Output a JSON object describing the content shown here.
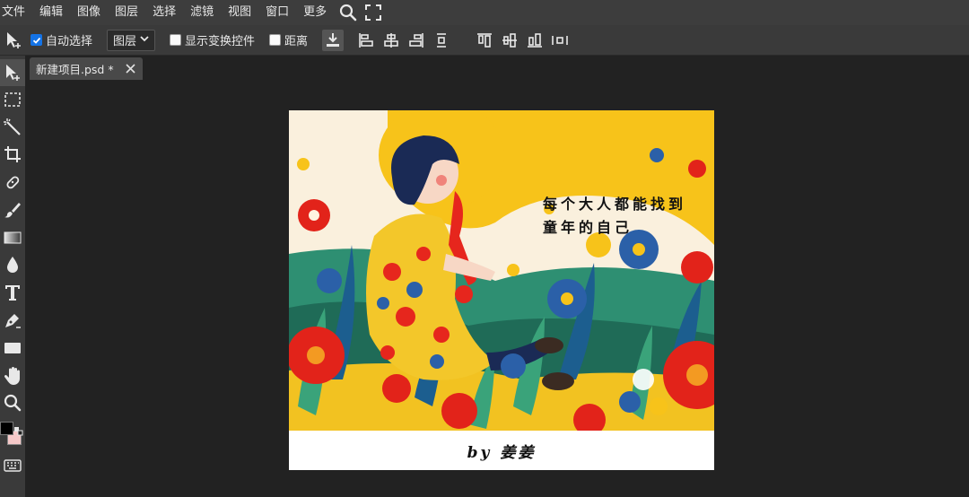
{
  "menubar": {
    "items": [
      "文件",
      "编辑",
      "图像",
      "图层",
      "选择",
      "滤镜",
      "视图",
      "窗口",
      "更多"
    ],
    "icons": [
      "search-icon",
      "fullscreen-icon"
    ]
  },
  "options": {
    "auto_select_label": "自动选择",
    "auto_select_checked": true,
    "layer_select_value": "图层",
    "show_transform_label": "显示变换控件",
    "show_transform_checked": false,
    "distance_label": "距离",
    "distance_checked": false
  },
  "document": {
    "tab_label": "新建项目.psd *"
  },
  "artwork": {
    "text_line1": "每个大人都能找到",
    "text_line2": "童年的自己",
    "caption": "by  姜姜"
  },
  "colors": {
    "foreground": "#000000",
    "background": "#f6c9c9",
    "accent": "#1473e6"
  }
}
